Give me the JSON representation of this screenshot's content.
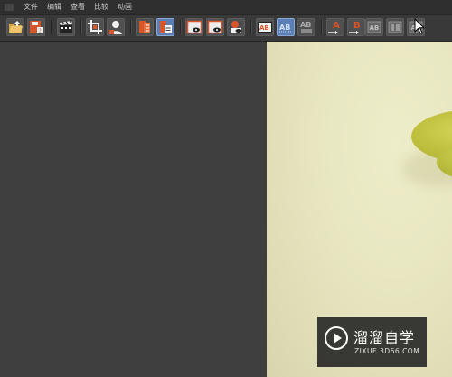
{
  "menubar": {
    "items": [
      {
        "label": "文件"
      },
      {
        "label": "编辑"
      },
      {
        "label": "查看"
      },
      {
        "label": "比较"
      },
      {
        "label": "动画"
      }
    ]
  },
  "toolbar": {
    "buttons": [
      {
        "icon": "open-folder-icon",
        "active": false
      },
      {
        "icon": "save-disk-icon",
        "active": false
      },
      {
        "icon": "clapper-board-icon",
        "active": false
      },
      {
        "icon": "crop-icon",
        "active": false
      },
      {
        "icon": "person-icon",
        "active": false
      },
      {
        "icon": "stack-red-icon",
        "active": false
      },
      {
        "icon": "stack-list-icon",
        "active": true
      },
      {
        "icon": "frame-eye-icon",
        "active": false
      },
      {
        "icon": "frame-eye-2-icon",
        "active": false
      },
      {
        "icon": "layers-person-icon",
        "active": false
      },
      {
        "icon": "ab-compare-icon",
        "active": false
      },
      {
        "icon": "ab-split-icon",
        "active": true
      },
      {
        "icon": "ab-stack-icon",
        "active": false
      },
      {
        "icon": "a-to-arrow-icon",
        "active": false
      },
      {
        "icon": "b-to-arrow-icon",
        "active": false
      },
      {
        "icon": "ab-box-icon",
        "active": false
      },
      {
        "icon": "ab-frame-icon",
        "active": false
      },
      {
        "icon": "ab-side-icon",
        "active": false
      }
    ],
    "ab_text": "AB",
    "a_text": "A",
    "b_text": "B"
  },
  "watermark": {
    "title": "溜溜自学",
    "subtitle": "ZIXUE.3D66.COM"
  },
  "colors": {
    "panel": "#3f3f3f",
    "toolbar": "#393939",
    "accent": "#5b7fb4",
    "icon_orange": "#d9552a"
  }
}
